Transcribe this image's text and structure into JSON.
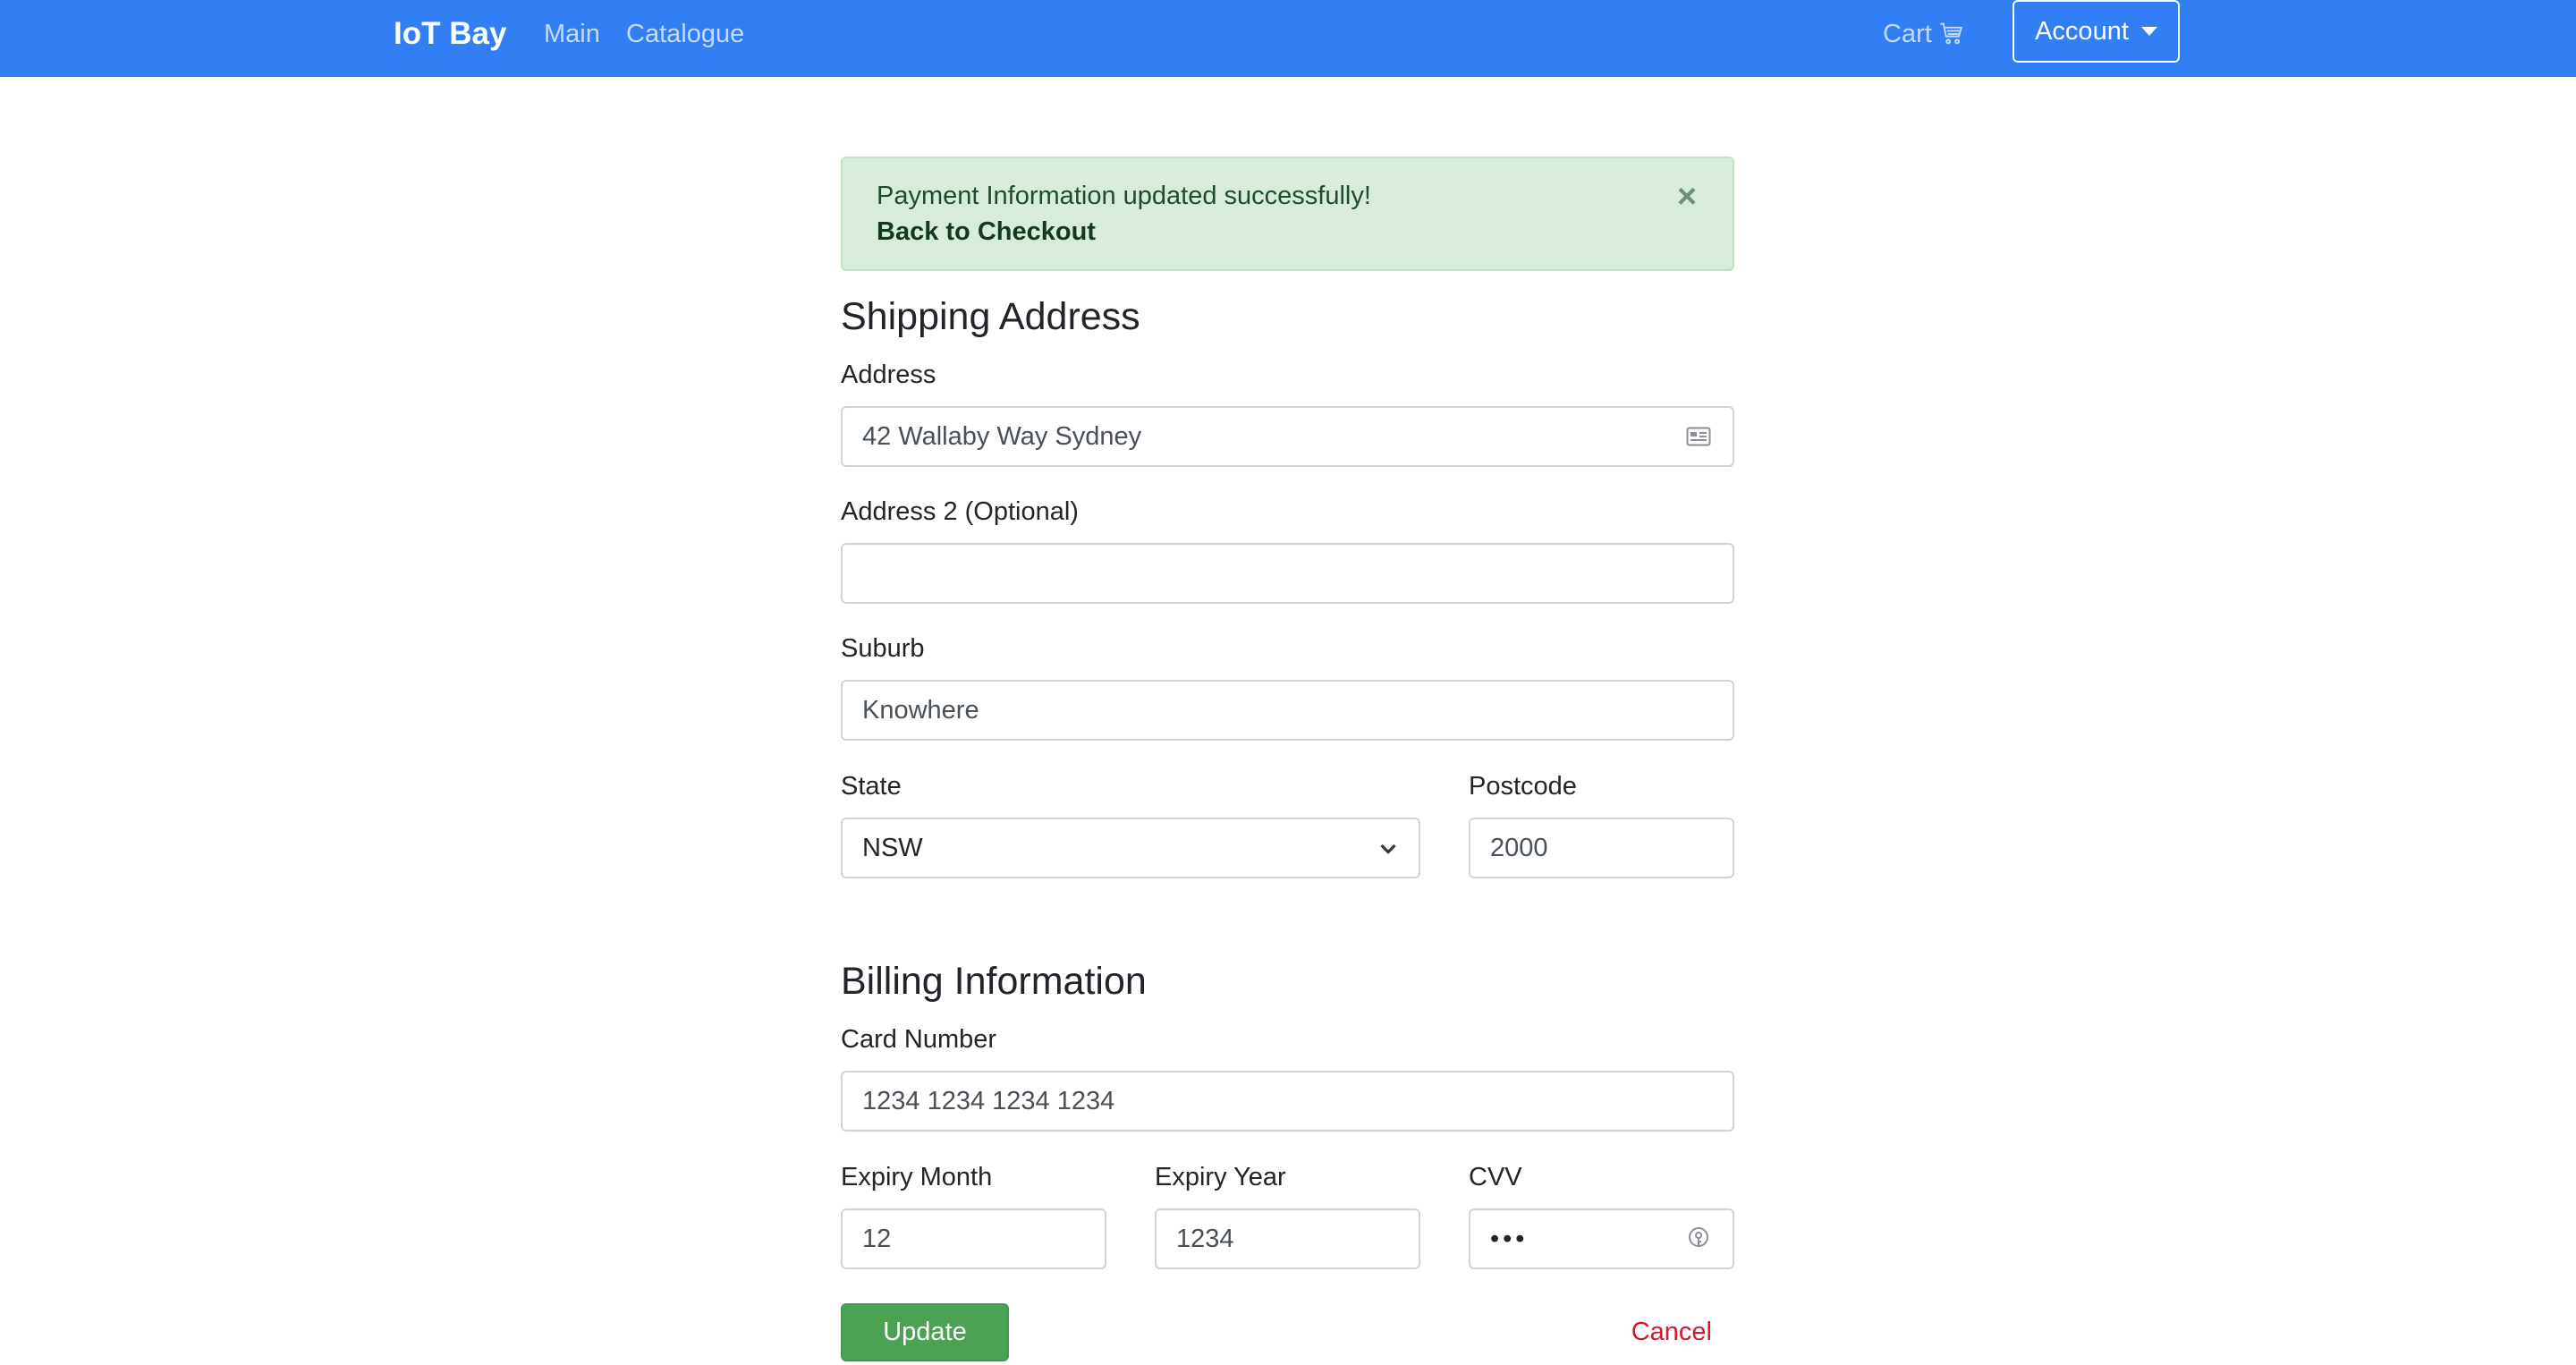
{
  "navbar": {
    "brand": "IoT Bay",
    "links": {
      "main": "Main",
      "catalogue": "Catalogue",
      "cart": "Cart"
    },
    "account_label": "Account",
    "bg_color": "#327ff5"
  },
  "alert": {
    "message": "Payment Information updated successfully!",
    "link_text": "Back to Checkout",
    "close_symbol": "×"
  },
  "shipping": {
    "title": "Shipping Address",
    "address_label": "Address",
    "address_value": "42 Wallaby Way Sydney",
    "address2_label": "Address 2 (Optional)",
    "address2_value": "",
    "suburb_label": "Suburb",
    "suburb_value": "Knowhere",
    "state_label": "State",
    "state_value": "NSW",
    "postcode_label": "Postcode",
    "postcode_value": "2000"
  },
  "billing": {
    "title": "Billing Information",
    "card_label": "Card Number",
    "card_value": "1234 1234 1234 1234",
    "expiry_month_label": "Expiry Month",
    "expiry_month_value": "12",
    "expiry_year_label": "Expiry Year",
    "expiry_year_value": "1234",
    "cvv_label": "CVV",
    "cvv_value": "•••"
  },
  "actions": {
    "update_label": "Update",
    "cancel_label": "Cancel"
  },
  "icons": {
    "cart": "cart-icon",
    "address_card": "address-card-icon",
    "password_key": "key-icon",
    "select_chevron": "chevron-down-icon"
  },
  "colors": {
    "success_bg": "#d9ecdc",
    "update_button": "#4aa252",
    "cancel_text": "#d11a2a"
  }
}
